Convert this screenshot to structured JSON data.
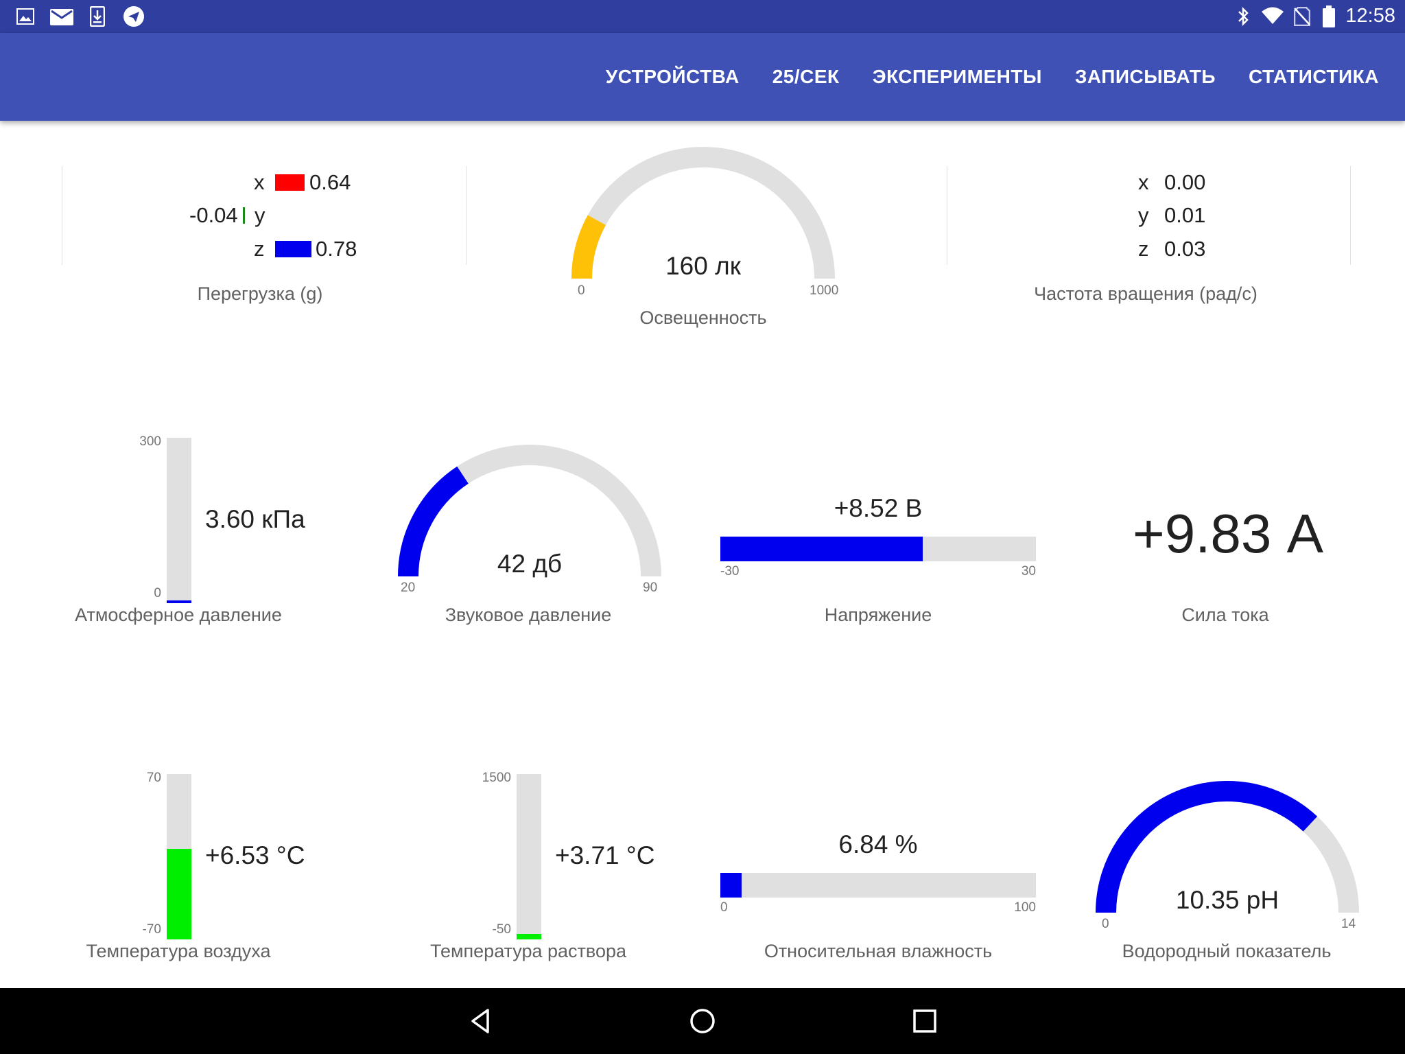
{
  "status_bar": {
    "time": "12:58",
    "icons_left": [
      "image-icon",
      "mail-icon",
      "download-icon",
      "telegram-icon"
    ],
    "icons_right": [
      "bluetooth-icon",
      "wifi-icon",
      "no-sim-icon",
      "battery-icon"
    ]
  },
  "menu": [
    "УСТРОЙСТВА",
    "25/СЕК",
    "ЭКСПЕРИМЕНТЫ",
    "ЗАПИСЫВАТЬ",
    "СТАТИСТИКА"
  ],
  "colors": {
    "status_bar": "#303f9f",
    "app_bar": "#3f51b5",
    "blue": "#0000ee",
    "red": "#ff0000",
    "green": "#00ee00",
    "amber": "#ffc107",
    "track": "#e0e0e0"
  },
  "acceleration": {
    "label": "Перегрузка (g)",
    "rows": [
      {
        "axis": "x",
        "value": "0.64",
        "num": 0.64,
        "color": "#ff0000"
      },
      {
        "axis": "y",
        "value": "-0.04",
        "num": -0.04,
        "color": "#1b8a1b"
      },
      {
        "axis": "z",
        "value": "0.78",
        "num": 0.78,
        "color": "#0000ee"
      }
    ]
  },
  "illuminance": {
    "label": "Освещенность",
    "value": "160 лк",
    "min": "0",
    "max": "1000",
    "num": 160,
    "range": [
      0,
      1000
    ],
    "color": "#ffc107"
  },
  "rotation": {
    "label": "Частота вращения (рад/с)",
    "rows": [
      {
        "axis": "x",
        "value": "0.00"
      },
      {
        "axis": "y",
        "value": "0.01"
      },
      {
        "axis": "z",
        "value": "0.03"
      }
    ]
  },
  "pressure": {
    "label": "Атмосферное давление",
    "value": "3.60 кПа",
    "max": "300",
    "min": "0",
    "num": 3.6,
    "range": [
      0,
      300
    ],
    "color": "#0000ee"
  },
  "sound": {
    "label": "Звуковое давление",
    "value": "42 дб",
    "min": "20",
    "max": "90",
    "num": 42,
    "range": [
      20,
      90
    ],
    "color": "#0000ee"
  },
  "voltage": {
    "label": "Напряжение",
    "value": "+8.52 В",
    "min": "-30",
    "max": "30",
    "num": 8.52,
    "range": [
      -30,
      30
    ],
    "color": "#0000ee"
  },
  "current": {
    "label": "Сила тока",
    "value": "+9.83 А"
  },
  "air_temp": {
    "label": "Температура воздуха",
    "value": "+6.53 °C",
    "max": "70",
    "min": "-70",
    "num": 6.53,
    "range": [
      -70,
      70
    ],
    "color": "#00ee00"
  },
  "solution_temp": {
    "label": "Температура раствора",
    "value": "+3.71 °C",
    "max": "1500",
    "min": "-50",
    "num": 3.71,
    "range": [
      -50,
      1500
    ],
    "color": "#00ee00"
  },
  "humidity": {
    "label": "Относительная влажность",
    "value": "6.84 %",
    "min": "0",
    "max": "100",
    "num": 6.84,
    "range": [
      0,
      100
    ],
    "color": "#0000ee"
  },
  "ph": {
    "label": "Водородный показатель",
    "value": "10.35 pH",
    "min": "0",
    "max": "14",
    "num": 10.35,
    "range": [
      0,
      14
    ],
    "color": "#0000ee"
  }
}
